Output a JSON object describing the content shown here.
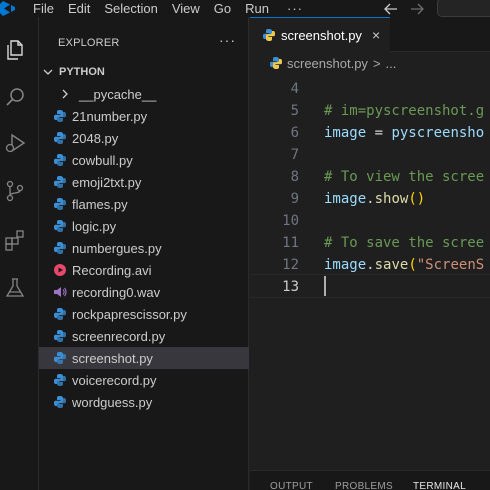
{
  "menubar": {
    "items": [
      "File",
      "Edit",
      "Selection",
      "View",
      "Go",
      "Run"
    ],
    "more": "···"
  },
  "activity_bar": {
    "icons": [
      "explorer-icon",
      "search-icon",
      "run-debug-icon",
      "source-control-icon",
      "extensions-icon",
      "testing-icon"
    ]
  },
  "sidebar": {
    "header": "EXPLORER",
    "more": "···",
    "folder": "PYTHON",
    "folder_items": [
      {
        "label": "__pycache__",
        "type": "folder"
      }
    ],
    "files": [
      {
        "label": "21number.py",
        "type": "py"
      },
      {
        "label": "2048.py",
        "type": "py"
      },
      {
        "label": "cowbull.py",
        "type": "py"
      },
      {
        "label": "emoji2txt.py",
        "type": "py"
      },
      {
        "label": "flames.py",
        "type": "py"
      },
      {
        "label": "logic.py",
        "type": "py"
      },
      {
        "label": "numbergues.py",
        "type": "py"
      },
      {
        "label": "Recording.avi",
        "type": "video"
      },
      {
        "label": "recording0.wav",
        "type": "audio"
      },
      {
        "label": "rockpaprescissor.py",
        "type": "py"
      },
      {
        "label": "screenrecord.py",
        "type": "py"
      },
      {
        "label": "screenshot.py",
        "type": "py",
        "selected": true
      },
      {
        "label": "voicerecord.py",
        "type": "py"
      },
      {
        "label": "wordguess.py",
        "type": "py"
      }
    ]
  },
  "editor": {
    "tab_label": "screenshot.py",
    "tab_close": "×",
    "breadcrumb_file": "screenshot.py",
    "breadcrumb_sep": ">",
    "breadcrumb_more": "...",
    "lines": [
      {
        "number": "4",
        "tokens": []
      },
      {
        "number": "5",
        "tokens": [
          {
            "t": "# im=pyscreenshot.g",
            "c": "comment"
          }
        ]
      },
      {
        "number": "6",
        "tokens": [
          {
            "t": "image",
            "c": "var"
          },
          {
            "t": " = ",
            "c": "op"
          },
          {
            "t": "pyscreensho",
            "c": "var"
          }
        ]
      },
      {
        "number": "7",
        "tokens": []
      },
      {
        "number": "8",
        "tokens": [
          {
            "t": "# To view the scree",
            "c": "comment"
          }
        ]
      },
      {
        "number": "9",
        "tokens": [
          {
            "t": "image",
            "c": "var"
          },
          {
            "t": ".",
            "c": "op"
          },
          {
            "t": "show",
            "c": "fn"
          },
          {
            "t": "()",
            "c": "paren"
          }
        ]
      },
      {
        "number": "10",
        "tokens": []
      },
      {
        "number": "11",
        "tokens": [
          {
            "t": "# To save the scree",
            "c": "comment"
          }
        ]
      },
      {
        "number": "12",
        "tokens": [
          {
            "t": "image",
            "c": "var"
          },
          {
            "t": ".",
            "c": "op"
          },
          {
            "t": "save",
            "c": "fn"
          },
          {
            "t": "(",
            "c": "paren"
          },
          {
            "t": "\"ScreenS",
            "c": "str"
          }
        ]
      },
      {
        "number": "13",
        "tokens": [],
        "active": true
      }
    ]
  },
  "panel": {
    "tabs": [
      "OUTPUT",
      "PROBLEMS",
      "TERMINAL"
    ],
    "active_tab": "TERMINAL"
  },
  "colors": {
    "accent": "#0078d4",
    "python_icon": "#3b8fd6",
    "video_icon": "#e8486b",
    "audio_icon": "#a074c4"
  }
}
